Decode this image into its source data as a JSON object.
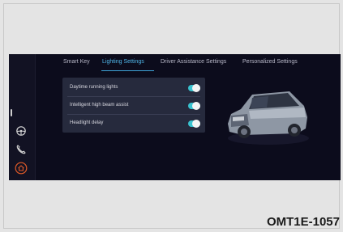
{
  "tabs": [
    {
      "label": "Smart Key",
      "active": false
    },
    {
      "label": "Lighting Settings",
      "active": true
    },
    {
      "label": "Driver Assistance Settings",
      "active": false
    },
    {
      "label": "Personalized Settings",
      "active": false
    }
  ],
  "settings": [
    {
      "label": "Daytime running lights",
      "enabled": true
    },
    {
      "label": "Intelligent high beam assist",
      "enabled": true
    },
    {
      "label": "Headlight delay",
      "enabled": true
    }
  ],
  "rail_icons": [
    "steering-wheel-icon",
    "phone-icon",
    "home-icon"
  ],
  "caption": "OMT1E-1057",
  "colors": {
    "accent": "#4fb6e8",
    "toggle_on": "#39c2cf",
    "home_icon": "#e05a28"
  }
}
